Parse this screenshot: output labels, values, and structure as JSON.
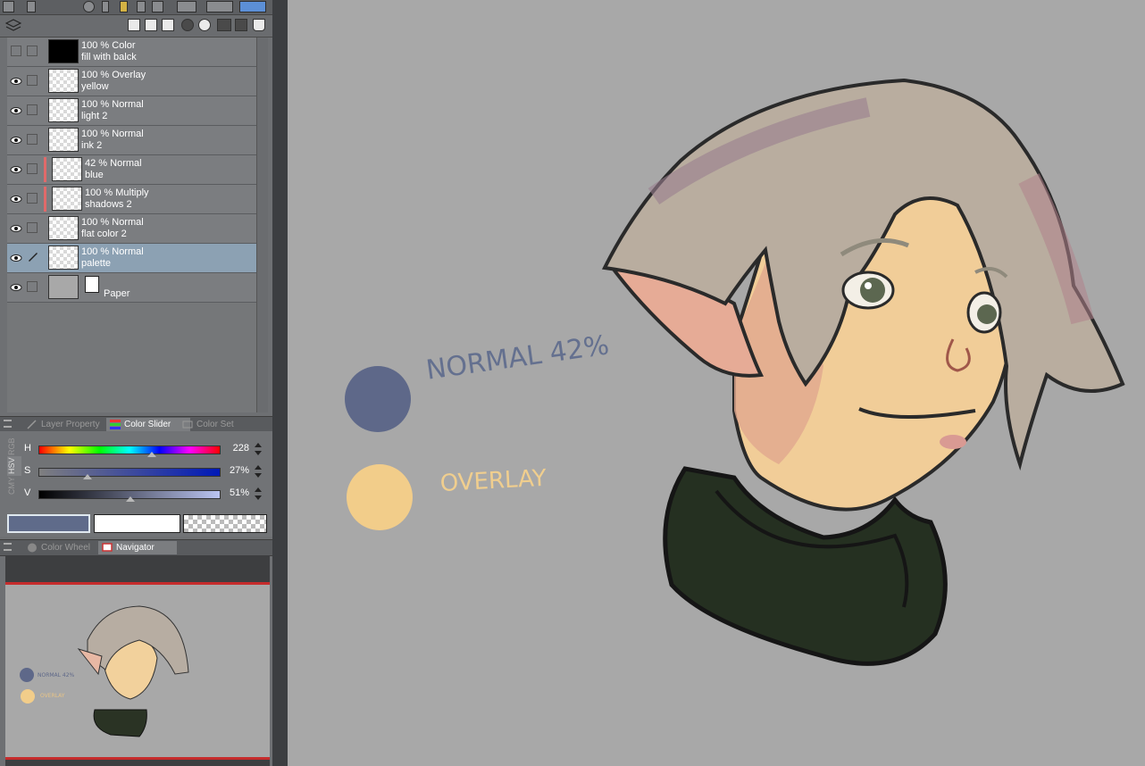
{
  "layers": [
    {
      "opacity_mode": "100 % Color",
      "name": "fill with balck",
      "visible": false,
      "thumb": "black",
      "clipped": false,
      "selected": false
    },
    {
      "opacity_mode": "100 % Overlay",
      "name": "yellow",
      "visible": true,
      "thumb": "checker",
      "clipped": false,
      "selected": false
    },
    {
      "opacity_mode": "100 % Normal",
      "name": "light 2",
      "visible": true,
      "thumb": "checker",
      "clipped": false,
      "selected": false
    },
    {
      "opacity_mode": "100 % Normal",
      "name": "ink 2",
      "visible": true,
      "thumb": "checker",
      "clipped": false,
      "selected": false
    },
    {
      "opacity_mode": "42 % Normal",
      "name": "blue",
      "visible": true,
      "thumb": "checker",
      "clipped": true,
      "selected": false
    },
    {
      "opacity_mode": "100 % Multiply",
      "name": "shadows 2",
      "visible": true,
      "thumb": "checker",
      "clipped": true,
      "selected": false
    },
    {
      "opacity_mode": "100 % Normal",
      "name": "flat color 2",
      "visible": true,
      "thumb": "checker",
      "clipped": false,
      "selected": false
    },
    {
      "opacity_mode": "100 % Normal",
      "name": "palette",
      "visible": true,
      "thumb": "checker",
      "clipped": false,
      "selected": true
    }
  ],
  "paper_layer": {
    "name": "Paper"
  },
  "palette_tabs": {
    "layer_property": "Layer Property",
    "color_slider": "Color Slider",
    "color_set": "Color Set"
  },
  "color_mode_tabs": [
    "RGB",
    "HSV",
    "CMY"
  ],
  "sliders": {
    "h": {
      "label": "H",
      "value": "228",
      "fraction": 0.63
    },
    "s": {
      "label": "S",
      "value": "27%",
      "fraction": 0.27
    },
    "v": {
      "label": "V",
      "value": "51%",
      "fraction": 0.51
    }
  },
  "colors": {
    "main": "#5f6b8a",
    "sub": "#ffffff",
    "blue_swatch": "#5e6889",
    "yellow_swatch": "#f2cd8a",
    "selected_layer": "#8ca1b3"
  },
  "nav_tabs": {
    "color_wheel": "Color Wheel",
    "navigator": "Navigator"
  },
  "canvas": {
    "label_normal": "NORMAL 42%",
    "label_overlay": "OVERLAY"
  },
  "icons": [
    "eye-icon",
    "pen-icon",
    "new-layer-icon",
    "trash-icon",
    "layer-menu-icon",
    "paper-icon"
  ]
}
